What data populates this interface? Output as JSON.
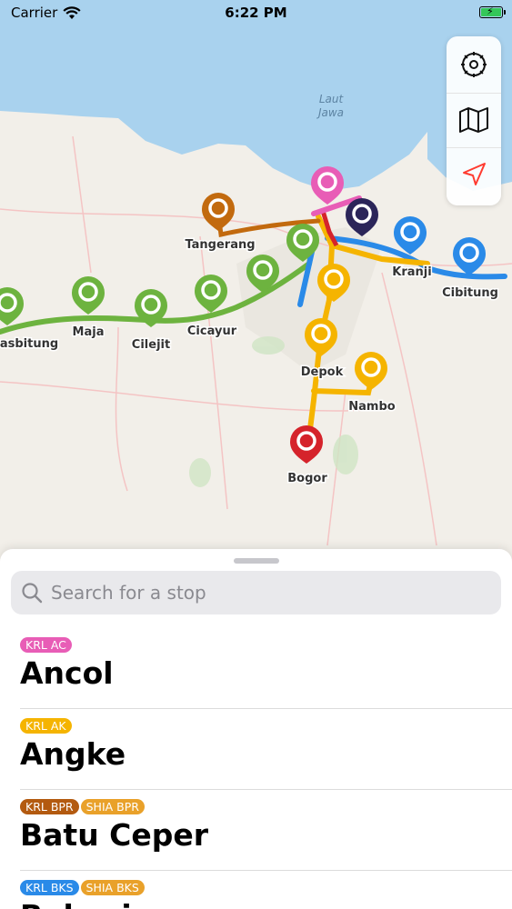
{
  "status_bar": {
    "carrier": "Carrier",
    "time": "6:22 PM"
  },
  "map": {
    "sea_label": [
      "Laut",
      "Jawa"
    ],
    "places": [
      "Tangerang",
      "Kranji",
      "Cibitung",
      "asbitung",
      "Maja",
      "Cilejit",
      "Cicayur",
      "Depok",
      "Nambo",
      "Bogor"
    ],
    "colors": {
      "sea": "#a9d2ee",
      "land": "#f2efe9",
      "green": "#6db33f",
      "orange": "#f5b400",
      "blue": "#2a8ae8",
      "brown": "#c26a0e",
      "pink": "#e85db6",
      "red": "#d5232b",
      "navy": "#2b2559"
    }
  },
  "map_controls": [
    "gear-icon",
    "map-icon",
    "location-arrow-icon"
  ],
  "search": {
    "placeholder": "Search for a stop"
  },
  "stops": [
    {
      "name": "Ancol",
      "tags": [
        {
          "label": "KRL AC",
          "color": "#e85db6"
        }
      ]
    },
    {
      "name": "Angke",
      "tags": [
        {
          "label": "KRL AK",
          "color": "#f5b400"
        }
      ]
    },
    {
      "name": "Batu Ceper",
      "tags": [
        {
          "label": "KRL BPR",
          "color": "#b35a10"
        },
        {
          "label": "SHIA BPR",
          "color": "#e9a12a"
        }
      ]
    },
    {
      "name": "Bekasi",
      "tags": [
        {
          "label": "KRL BKS",
          "color": "#2a8ae8"
        },
        {
          "label": "SHIA BKS",
          "color": "#e9a12a"
        }
      ]
    }
  ]
}
